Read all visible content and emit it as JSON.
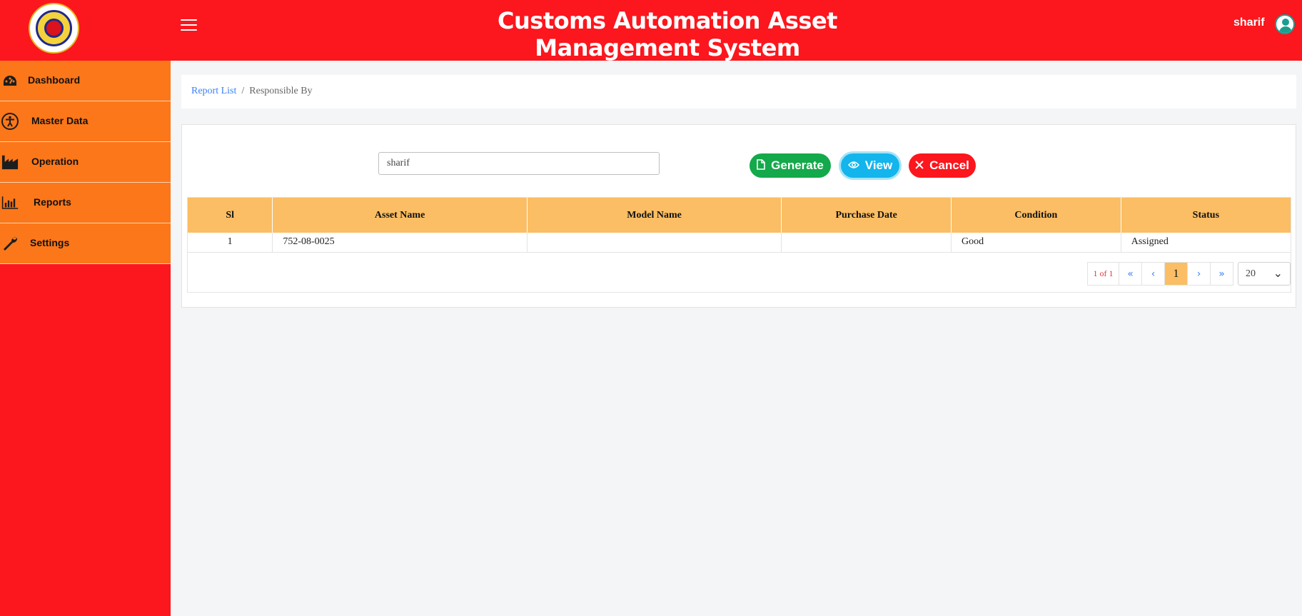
{
  "header": {
    "title": "Customs Automation Asset Management System",
    "username": "sharif",
    "logo_icon": "customs-emblem-logo",
    "hamburger_icon": "hamburger-menu-icon",
    "avatar_icon": "user-avatar-icon",
    "brand_color": "#fc161d"
  },
  "sidebar": {
    "accent": "#fc7719",
    "items": [
      {
        "label": "Dashboard",
        "icon": "speedometer-icon"
      },
      {
        "label": "Master Data",
        "icon": "accessibility-icon"
      },
      {
        "label": "Operation",
        "icon": "factory-icon"
      },
      {
        "label": "Reports",
        "icon": "bar-chart-icon"
      },
      {
        "label": "Settings",
        "icon": "wrench-icon"
      }
    ]
  },
  "breadcrumb": {
    "parent": "Report List",
    "separator": "/",
    "current": "Responsible By"
  },
  "form": {
    "responsible_value": "sharif",
    "generate_label": "Generate",
    "view_label": "View",
    "cancel_label": "Cancel"
  },
  "table": {
    "header_color": "#fbbe64",
    "columns": [
      "Sl",
      "Asset Name",
      "Model Name",
      "Purchase Date",
      "Condition",
      "Status"
    ],
    "rows": [
      {
        "sl": "1",
        "asset_name": "752-08-0025",
        "model_name": "",
        "purchase_date": "",
        "condition": "Good",
        "status": "Assigned"
      }
    ]
  },
  "pagination": {
    "info": "1 of 1",
    "first": "«",
    "prev": "‹",
    "current_page": "1",
    "next": "›",
    "last": "»",
    "page_size": "20"
  }
}
